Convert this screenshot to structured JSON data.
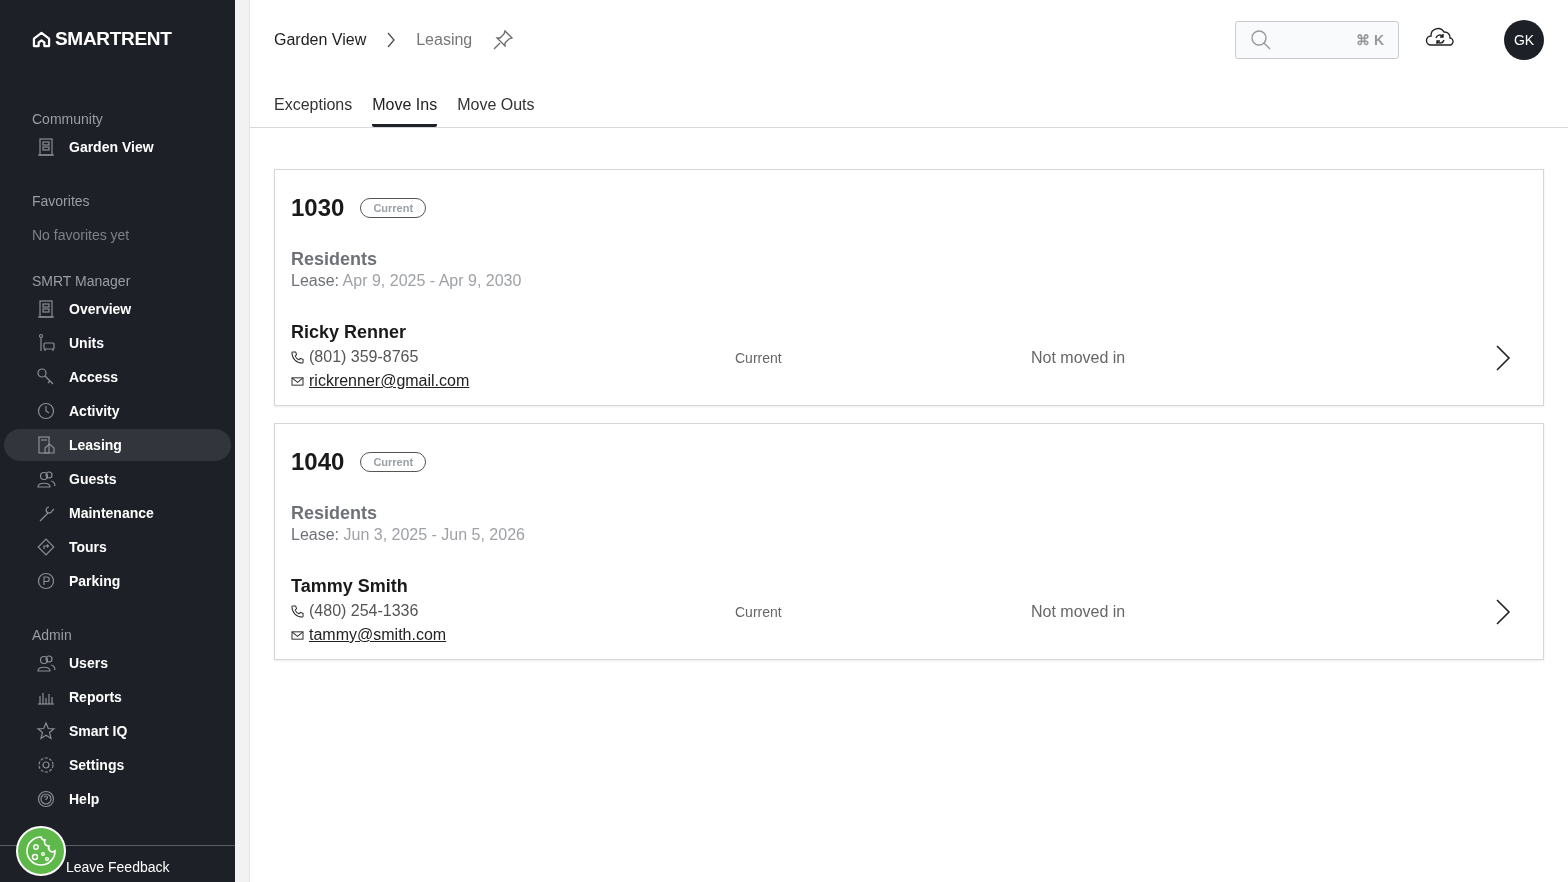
{
  "sidebar": {
    "logo": "SMARTRENT",
    "sections": [
      {
        "title": "Community",
        "items": [
          {
            "label": "Garden View",
            "selected": false
          }
        ]
      },
      {
        "title": "Favorites",
        "note": "No favorites yet"
      },
      {
        "title": "SMRT Manager",
        "items": [
          {
            "label": "Overview",
            "selected": false
          },
          {
            "label": "Units",
            "selected": false
          },
          {
            "label": "Access",
            "selected": false
          },
          {
            "label": "Activity",
            "selected": false
          },
          {
            "label": "Leasing",
            "selected": true
          },
          {
            "label": "Guests",
            "selected": false
          },
          {
            "label": "Maintenance",
            "selected": false
          },
          {
            "label": "Tours",
            "selected": false
          },
          {
            "label": "Parking",
            "selected": false
          }
        ]
      },
      {
        "title": "Admin",
        "items": [
          {
            "label": "Users",
            "selected": false
          },
          {
            "label": "Reports",
            "selected": false
          },
          {
            "label": "Smart IQ",
            "selected": false
          },
          {
            "label": "Settings",
            "selected": false
          },
          {
            "label": "Help",
            "selected": false
          }
        ]
      }
    ],
    "feedback": "Leave Feedback"
  },
  "breadcrumb": [
    "Garden View",
    "Leasing"
  ],
  "search": {
    "shortcut": "⌘ K"
  },
  "avatar": "GK",
  "tabs": [
    {
      "label": "Exceptions",
      "selected": false
    },
    {
      "label": "Move Ins",
      "selected": true
    },
    {
      "label": "Move Outs",
      "selected": false
    }
  ],
  "units": [
    {
      "unit": "1030",
      "badge": "Current",
      "residents_heading": "Residents",
      "lease_label": "Lease:",
      "lease": "Apr 9, 2025 - Apr 9, 2030",
      "resident": {
        "name": "Ricky Renner",
        "phone": "(801) 359-8765",
        "email": "rickrenner@gmail.com",
        "status": "Current",
        "move_in": "Not moved in"
      }
    },
    {
      "unit": "1040",
      "badge": "Current",
      "residents_heading": "Residents",
      "lease_label": "Lease:",
      "lease": "Jun 3, 2025 - Jun 5, 2026",
      "resident": {
        "name": "Tammy Smith",
        "phone": "(480) 254-1336",
        "email": "tammy@smith.com",
        "status": "Current",
        "move_in": "Not moved in"
      }
    }
  ]
}
